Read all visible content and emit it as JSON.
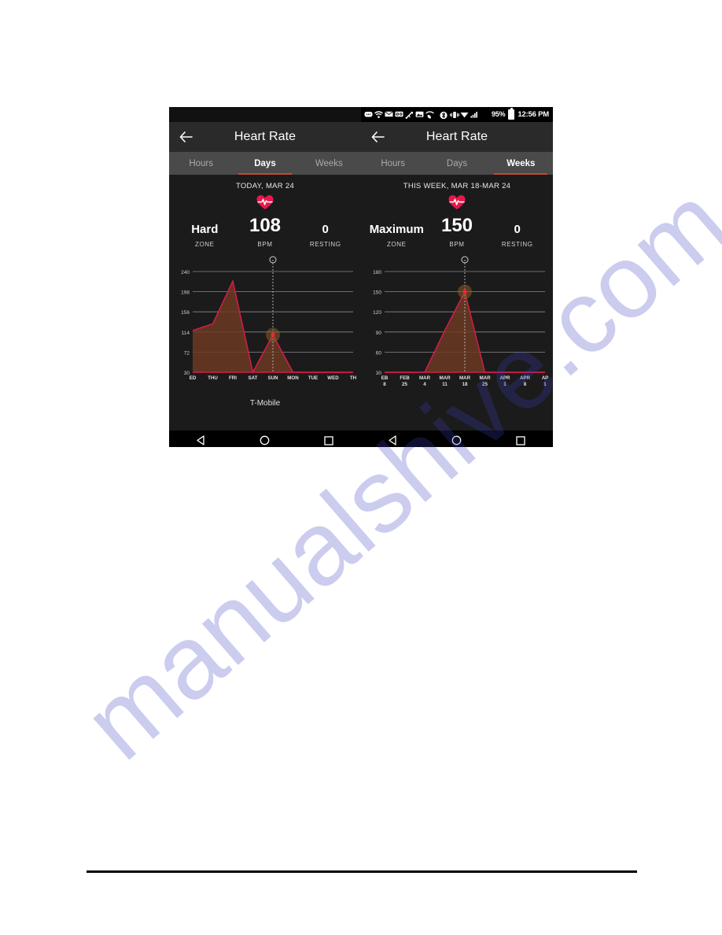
{
  "page": {
    "background": "#ffffff",
    "watermark_text": "manualshive.com",
    "watermark_color": "#3a3fbf",
    "rule_color": "#000000"
  },
  "theme": {
    "accent_red": "#d81b4a",
    "tab_indicator": "#c8482f",
    "heart_color": "#e8174a",
    "appbar_bg": "#2a2a2a",
    "tab_bg": "#4a4a4a",
    "content_bg": "#1b1b1b",
    "grid_color": "#8a8a8a",
    "marker_color": "#ff1f3d",
    "marker_glow": "#8a5a28"
  },
  "phones": [
    {
      "id": "left",
      "statusbar": {
        "visible": false,
        "icons_left": [],
        "icons_right": [],
        "battery_percent": "",
        "time": ""
      },
      "appbar": {
        "back_icon": "arrow-left-icon",
        "title": "Heart Rate"
      },
      "tabs": [
        {
          "label": "Hours",
          "active": false
        },
        {
          "label": "Days",
          "active": true
        },
        {
          "label": "Weeks",
          "active": false
        }
      ],
      "date_header": "TODAY, MAR 24",
      "heart_icon": "heart-pulse-icon",
      "stats": [
        {
          "value": "Hard",
          "label": "ZONE"
        },
        {
          "value": "108",
          "label": "BPM"
        },
        {
          "value": "0",
          "label": "RESTING"
        }
      ],
      "carrier": "T-Mobile",
      "navbar": [
        "back-triangle-icon",
        "home-circle-icon",
        "recents-square-icon"
      ],
      "chart_data": {
        "type": "area",
        "title": "TODAY, MAR 24",
        "xlabel": "",
        "ylabel": "BPM",
        "ylim": [
          30,
          240
        ],
        "yticks": [
          240,
          198,
          156,
          114,
          72,
          30
        ],
        "categories": [
          "ED",
          "THU",
          "FRI",
          "SAT",
          "SUN",
          "MON",
          "TUE",
          "WED",
          "TH"
        ],
        "values": [
          117,
          131,
          220,
          30,
          108,
          30,
          30,
          30,
          30
        ],
        "grid": true,
        "legend": "none",
        "highlight": {
          "category": "SUN",
          "value": 108,
          "label": "108"
        },
        "line_color": "#d81b4a",
        "fill_color": "#6b3a22"
      }
    },
    {
      "id": "right",
      "statusbar": {
        "visible": true,
        "icons_left": [
          "message-icon",
          "wifi-calling-icon",
          "envelope-icon",
          "voicemail-icon",
          "usb-icon",
          "image-icon",
          "call-wifi-icon"
        ],
        "icons_right": [
          "bluetooth-icon",
          "vibrate-icon",
          "wifi-icon",
          "signal-bars-icon"
        ],
        "battery_percent": "95%",
        "battery_icon": "battery-icon",
        "time": "12:56 PM"
      },
      "appbar": {
        "back_icon": "arrow-left-icon",
        "title": "Heart Rate"
      },
      "tabs": [
        {
          "label": "Hours",
          "active": false
        },
        {
          "label": "Days",
          "active": false
        },
        {
          "label": "Weeks",
          "active": true
        }
      ],
      "date_header": "THIS WEEK, MAR 18-MAR 24",
      "heart_icon": "heart-pulse-icon",
      "stats": [
        {
          "value": "Maximum",
          "label": "ZONE"
        },
        {
          "value": "150",
          "label": "BPM"
        },
        {
          "value": "0",
          "label": "RESTING"
        }
      ],
      "carrier": "",
      "navbar": [
        "back-triangle-icon",
        "home-circle-icon",
        "recents-square-icon"
      ],
      "chart_data": {
        "type": "area",
        "title": "THIS WEEK, MAR 18-MAR 24",
        "xlabel": "",
        "ylabel": "BPM",
        "ylim": [
          30,
          180
        ],
        "yticks": [
          180,
          150,
          120,
          90,
          60,
          30
        ],
        "categories": [
          "EB 8",
          "FEB 25",
          "MAR 4",
          "MAR 11",
          "MAR 18",
          "MAR 25",
          "APR 1",
          "APR 8",
          "AP 1"
        ],
        "categories_two_line": [
          [
            "EB",
            "8"
          ],
          [
            "FEB",
            "25"
          ],
          [
            "MAR",
            "4"
          ],
          [
            "MAR",
            "11"
          ],
          [
            "MAR",
            "18"
          ],
          [
            "MAR",
            "25"
          ],
          [
            "APR",
            "1"
          ],
          [
            "APR",
            "8"
          ],
          [
            "AP",
            "1"
          ]
        ],
        "values": [
          30,
          30,
          30,
          92,
          150,
          30,
          30,
          30,
          30
        ],
        "grid": true,
        "legend": "none",
        "highlight": {
          "category": "MAR 18",
          "value": 150,
          "label": "150"
        },
        "line_color": "#d81b4a",
        "fill_color": "#6b3a22"
      }
    }
  ]
}
